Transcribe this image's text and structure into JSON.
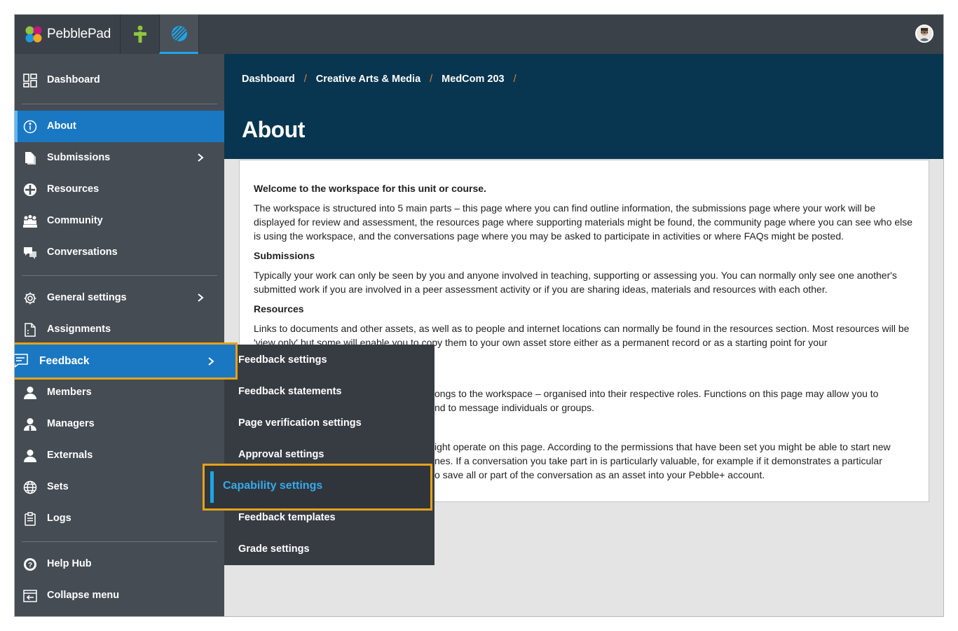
{
  "app": {
    "name": "PebblePad"
  },
  "breadcrumb": [
    "Dashboard",
    "Creative Arts & Media",
    "MedCom 203"
  ],
  "page_title": "About",
  "sidebar": {
    "dashboard": "Dashboard",
    "about": "About",
    "submissions": "Submissions",
    "resources": "Resources",
    "community": "Community",
    "conversations": "Conversations",
    "general_settings": "General settings",
    "assignments": "Assignments",
    "feedback": "Feedback",
    "members": "Members",
    "managers": "Managers",
    "externals": "Externals",
    "sets": "Sets",
    "logs": "Logs",
    "help_hub": "Help Hub",
    "collapse_menu": "Collapse menu"
  },
  "submenu": {
    "items": [
      "Feedback settings",
      "Feedback statements",
      "Page verification settings",
      "Approval settings",
      "Capability settings",
      "Feedback templates",
      "Grade settings"
    ],
    "selected": "Capability settings"
  },
  "content": {
    "welcome": "Welcome to the workspace for this unit or course.",
    "intro": "The workspace is structured into 5 main parts – this page where you can find outline information, the submissions page where your work will be displayed for review and assessment, the resources page where supporting materials might be found, the community page where you can see who else is using the workspace, and the conversations page where you may be asked to participate in activities or where FAQs might be posted.",
    "submissions_heading": "Submissions",
    "submissions_text": "Typically your work can only be seen by you and anyone involved in teaching, supporting or assessing you. You can normally only see one another's submitted work if you are involved in a peer assessment activity or if you are sharing ideas, materials and resources with each other.",
    "resources_heading": "Resources",
    "resources_text": "Links to documents and other assets, as well as to people and internet locations can normally be found in the resources section. Most resources will be 'view only' but some will enable you to copy them to your own asset store either as a permanent record or as a starting point for your",
    "community_text_1": "ongs to the workspace – organised into their respective roles. Functions on this page may allow you to",
    "community_text_2": "nd to message individuals or groups.",
    "conversations_text_1": "ight operate on this page. According to the permissions that have been set you might be able to start new",
    "conversations_text_2": "nes. If a conversation you take part in is particularly valuable, for example if it demonstrates a particular",
    "conversations_text_3": "o save all or part of the conversation as an asset into your Pebble+ account."
  },
  "colors": {
    "accent": "#1a78c2",
    "highlight": "#e5a21a",
    "header": "#08354f",
    "sidebar": "#454c54"
  }
}
